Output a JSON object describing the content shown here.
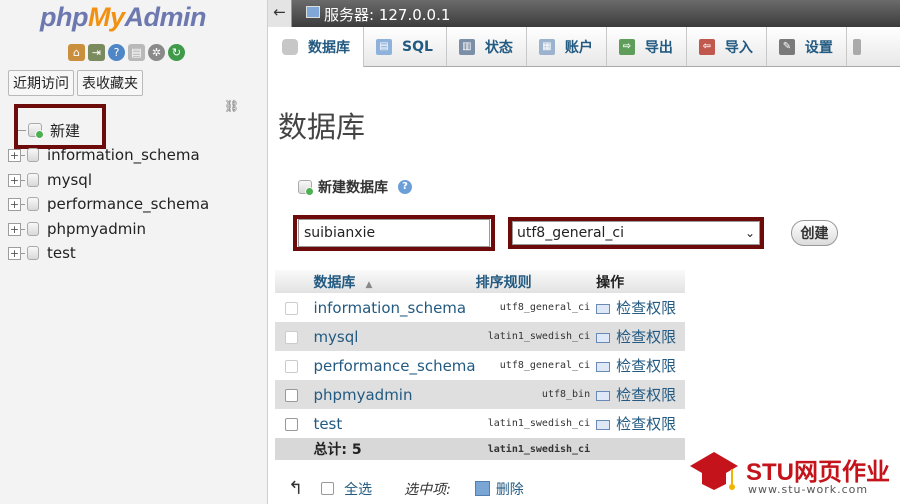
{
  "nav": {
    "logo": {
      "php": "php",
      "my": "My",
      "admin": "Admin"
    },
    "buttons": {
      "recent": "近期访问",
      "favorites": "表收藏夹"
    },
    "new_label": "新建",
    "databases": [
      "information_schema",
      "mysql",
      "performance_schema",
      "phpmyadmin",
      "test"
    ]
  },
  "topbar": {
    "collapse": "←",
    "server": "服务器: 127.0.0.1"
  },
  "tabs": [
    "数据库",
    "SQL",
    "状态",
    "账户",
    "导出",
    "导入",
    "设置"
  ],
  "main": {
    "title": "数据库",
    "create_heading": "新建数据库",
    "db_name_value": "suibianxie",
    "collation_value": "utf8_general_ci",
    "create_button": "创建"
  },
  "table": {
    "headers": {
      "database": "数据库",
      "collation": "排序规则",
      "action": "操作"
    },
    "rows": [
      {
        "name": "information_schema",
        "collation": "utf8_general_ci",
        "action": "检查权限"
      },
      {
        "name": "mysql",
        "collation": "latin1_swedish_ci",
        "action": "检查权限"
      },
      {
        "name": "performance_schema",
        "collation": "utf8_general_ci",
        "action": "检查权限"
      },
      {
        "name": "phpmyadmin",
        "collation": "utf8_bin",
        "action": "检查权限"
      },
      {
        "name": "test",
        "collation": "latin1_swedish_ci",
        "action": "检查权限"
      }
    ],
    "total": {
      "label": "总计: 5",
      "collation": "latin1_swedish_ci"
    }
  },
  "bottom": {
    "select_all": "全选",
    "with_selected": "选中项:",
    "delete": "删除"
  },
  "watermark": {
    "brand": "STU网页作业",
    "url": "www.stu-work.com"
  },
  "colors": {
    "link": "#235a81",
    "highlight_box": "#6d0b0b",
    "watermark_red": "#c4131b"
  }
}
